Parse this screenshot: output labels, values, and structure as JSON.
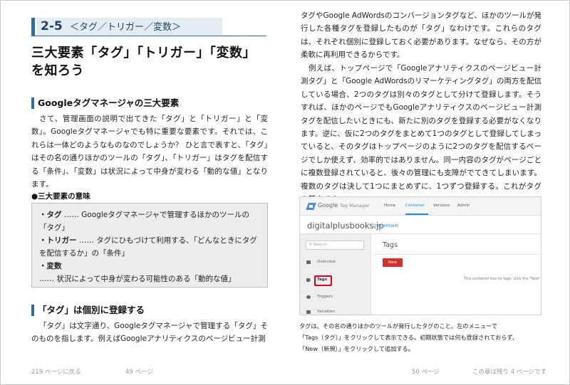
{
  "left_page": {
    "section_number": "2-5",
    "section_title": "＜タグ／トリガー／変数＞",
    "main_title": "三大要素「タグ」「トリガー」「変数」を知ろう",
    "heading1": "Googleタグマネージャの三大要素",
    "para1": "さて、管理画面の説明で出てきた「タグ」と「トリガー」と「変数」。Googleタグマネージャでも特に重要な要素です。それでは、これらは一体どのようなものなのでしょうか？ ひと言で表すと、「タグ」はその名の通りほかのツールの「タグ」、「トリガー」はタグを配信する「条件」、「変数」は状況によって中身が変わる「動的な値」となります。",
    "bullet_heading": "●三大要素の意味",
    "box_items": [
      {
        "term": "・タグ",
        "desc": " …… Googleタグマネージャで管理するほかのツールの「タグ」"
      },
      {
        "term": "・トリガー",
        "desc": " …… タグにひもづけて利用する、「どんなときにタグを配信するか」の「条件」"
      },
      {
        "term": "・変数",
        "desc": " …… 状況によって中身が変わる可能性のある「動的な値」"
      }
    ],
    "heading2": "「タグ」は個別に登録する",
    "para2": "「タグ」は文字通り、Googleタグマネージャで管理する「タグ」そのものを指します。例えばGoogleアナリティクスのページビュー計測",
    "footer_back": "219 ページに戻る",
    "footer_page": "49 ページ"
  },
  "right_page": {
    "para1": "タグやGoogle AdWordsのコンバージョンタグなど、ほかのツールが発行した各種タグを登録したものが「タグ」なわけです。これらのタグは、それぞれ個別に登録しておく必要があります。なぜなら、その方が柔軟に再利用できるからです。",
    "para2": "例えば、トップページで「Googleアナリティクスのページビュー計測タグ」と「Google AdWordsのリマーケティングタグ」の両方を配信している場合、2つのタグは別々のタグとして分けて登録します。そうすれば、ほかのページでもGoogleアナリティクスのページビュー計測タグを配信したいときにも、新たに別のタグを登録する必要がなくなります。逆に、仮に2つのタグをまとめて1つのタグとして登録してしまっていると、そのタグはトップページのように2つのタグを配信するページでしか使えず、効率的ではありません。同一内容のタグがページごとに複数登録されていると、後々の管理にも支障がでてきてしまいます。複数のタグは決して1つにまとめずに、1つずつ登録する。これがタグの基本です。",
    "screenshot": {
      "google": "Google",
      "product": "Tag Manager",
      "nav": [
        "Home",
        "Container",
        "Versions",
        "Admin"
      ],
      "account": "digitalplusbooks.jp",
      "container_id": "GTM-WHSW4C",
      "search_placeholder": "Search",
      "sidebar": [
        "Overview",
        "Tags",
        "Triggers",
        "Variables"
      ],
      "main_title": "Tags",
      "new_button": "New",
      "empty_message": "This container has no tags, click the \"New\""
    },
    "caption": [
      "タグは、その名の通りほかのツールが発行したタグのこと。左のメニューで",
      "「Tags（タグ）」をクリックして表示できる。初期状態では何も登録されておらず、",
      "「New（新規）」をクリックして追加する。"
    ],
    "footer_page": "50 ページ",
    "footer_remaining": "この章は残り 4 ページです"
  }
}
